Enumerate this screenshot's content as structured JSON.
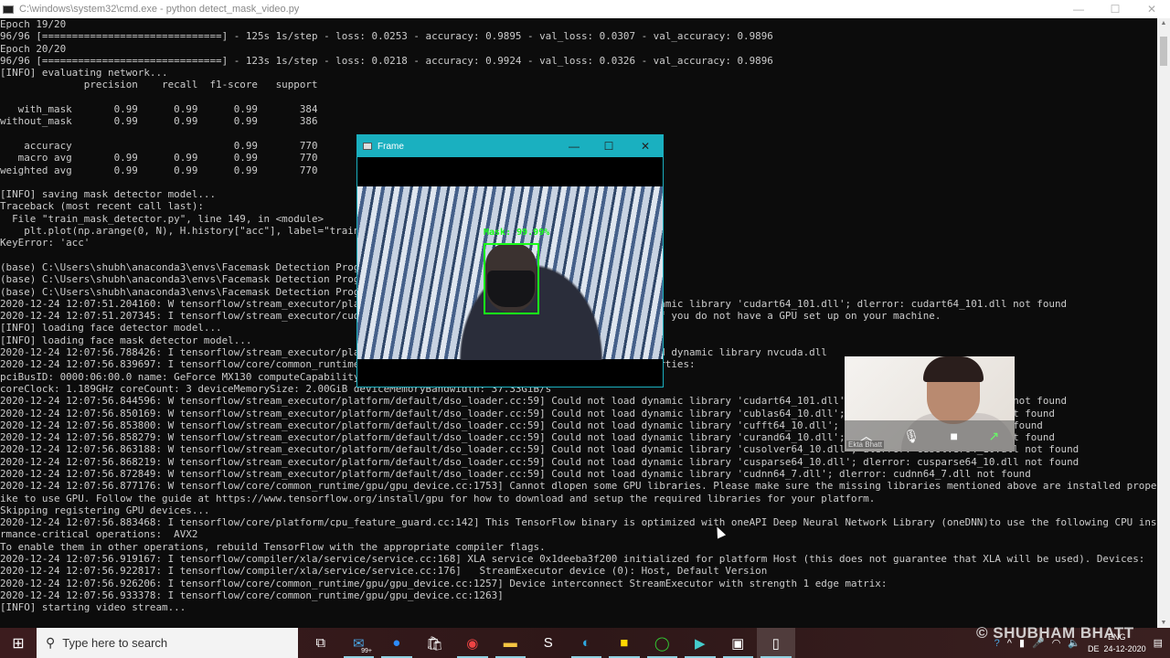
{
  "window": {
    "title": "C:\\windows\\system32\\cmd.exe - python  detect_mask_video.py",
    "minimize": "—",
    "maximize": "☐",
    "close": "✕"
  },
  "terminal": {
    "lines": [
      "Epoch 19/20",
      "96/96 [==============================] - 125s 1s/step - loss: 0.0253 - accuracy: 0.9895 - val_loss: 0.0307 - val_accuracy: 0.9896",
      "Epoch 20/20",
      "96/96 [==============================] - 123s 1s/step - loss: 0.0218 - accuracy: 0.9924 - val_loss: 0.0326 - val_accuracy: 0.9896",
      "[INFO] evaluating network...",
      "              precision    recall  f1-score   support",
      "",
      "   with_mask       0.99      0.99      0.99       384",
      "without_mask       0.99      0.99      0.99       386",
      "",
      "    accuracy                           0.99       770",
      "   macro avg       0.99      0.99      0.99       770",
      "weighted avg       0.99      0.99      0.99       770",
      "",
      "[INFO] saving mask detector model...",
      "Traceback (most recent call last):",
      "  File \"train_mask_detector.py\", line 149, in <module>",
      "    plt.plot(np.arange(0, N), H.history[\"acc\"], label=\"train_acc\")",
      "KeyError: 'acc'",
      "",
      "(base) C:\\Users\\shubh\\anaconda3\\envs\\Facemask Detection Program>",
      "(base) C:\\Users\\shubh\\anaconda3\\envs\\Facemask Detection Program>",
      "(base) C:\\Users\\shubh\\anaconda3\\envs\\Facemask Detection Program>python detect_mask_video.py",
      "2020-12-24 12:07:51.204160: W tensorflow/stream_executor/platform/default/dso_loader.cc:59] Could not load dynamic library 'cudart64_101.dll'; dlerror: cudart64_101.dll not found",
      "2020-12-24 12:07:51.207345: I tensorflow/stream_executor/cuda/cudart_stub.cc:29] Ignore above cudart dlerror if you do not have a GPU set up on your machine.",
      "[INFO] loading face detector model...",
      "[INFO] loading face mask detector model...",
      "2020-12-24 12:07:56.788426: I tensorflow/stream_executor/platform/default/dso_loader.cc:48] Successfully opened dynamic library nvcuda.dll",
      "2020-12-24 12:07:56.839697: I tensorflow/core/common_runtime/gpu/gpu_device.cc:1716] Found device 0 with properties:",
      "pciBusID: 0000:06:00.0 name: GeForce MX130 computeCapability: 5.0",
      "coreClock: 1.189GHz coreCount: 3 deviceMemorySize: 2.00GiB deviceMemoryBandwidth: 37.33GiB/s",
      "2020-12-24 12:07:56.844596: W tensorflow/stream_executor/platform/default/dso_loader.cc:59] Could not load dynamic library 'cudart64_101.dll'; dlerror: cudart64_101.dll not found",
      "2020-12-24 12:07:56.850169: W tensorflow/stream_executor/platform/default/dso_loader.cc:59] Could not load dynamic library 'cublas64_10.dll'; dlerror: cublas64_10.dll not found",
      "2020-12-24 12:07:56.853800: W tensorflow/stream_executor/platform/default/dso_loader.cc:59] Could not load dynamic library 'cufft64_10.dll'; dlerror: cufft64_10.dll not found",
      "2020-12-24 12:07:56.858279: W tensorflow/stream_executor/platform/default/dso_loader.cc:59] Could not load dynamic library 'curand64_10.dll'; dlerror: curand64_10.dll not found",
      "2020-12-24 12:07:56.863188: W tensorflow/stream_executor/platform/default/dso_loader.cc:59] Could not load dynamic library 'cusolver64_10.dll'; dlerror: cusolver64_10.dll not found",
      "2020-12-24 12:07:56.868219: W tensorflow/stream_executor/platform/default/dso_loader.cc:59] Could not load dynamic library 'cusparse64_10.dll'; dlerror: cusparse64_10.dll not found",
      "2020-12-24 12:07:56.872849: W tensorflow/stream_executor/platform/default/dso_loader.cc:59] Could not load dynamic library 'cudnn64_7.dll'; dlerror: cudnn64_7.dll not found",
      "2020-12-24 12:07:56.877176: W tensorflow/core/common_runtime/gpu/gpu_device.cc:1753] Cannot dlopen some GPU libraries. Please make sure the missing libraries mentioned above are installed properly if you would l",
      "ike to use GPU. Follow the guide at https://www.tensorflow.org/install/gpu for how to download and setup the required libraries for your platform.",
      "Skipping registering GPU devices...",
      "2020-12-24 12:07:56.883468: I tensorflow/core/platform/cpu_feature_guard.cc:142] This TensorFlow binary is optimized with oneAPI Deep Neural Network Library (oneDNN)to use the following CPU instructions in perfo",
      "rmance-critical operations:  AVX2",
      "To enable them in other operations, rebuild TensorFlow with the appropriate compiler flags.",
      "2020-12-24 12:07:56.919167: I tensorflow/compiler/xla/service/service.cc:168] XLA service 0x1deeba3f200 initialized for platform Host (this does not guarantee that XLA will be used). Devices:",
      "2020-12-24 12:07:56.922817: I tensorflow/compiler/xla/service/service.cc:176]   StreamExecutor device (0): Host, Default Version",
      "2020-12-24 12:07:56.926206: I tensorflow/core/common_runtime/gpu/gpu_device.cc:1257] Device interconnect StreamExecutor with strength 1 edge matrix:",
      "2020-12-24 12:07:56.933378: I tensorflow/core/common_runtime/gpu/gpu_device.cc:1263]",
      "[INFO] starting video stream..."
    ]
  },
  "frame_window": {
    "title": "Frame",
    "minimize": "—",
    "maximize": "☐",
    "close": "✕",
    "detection_label": "Mask: 99.99%",
    "box_color": "#19ff19",
    "titlebar_color": "#1ab0c0"
  },
  "video_call": {
    "participant": "Ekta Bhatt",
    "icons": [
      "chevron-up-icon",
      "microphone-icon",
      "camera-icon",
      "share-icon"
    ]
  },
  "taskbar": {
    "search_placeholder": "Type here to search",
    "mail_badge": "99+",
    "tray": {
      "language_top": "ENG",
      "language_bottom": "DE",
      "date": "24-12-2020"
    }
  },
  "watermark": "© SHUBHAM BHATT"
}
